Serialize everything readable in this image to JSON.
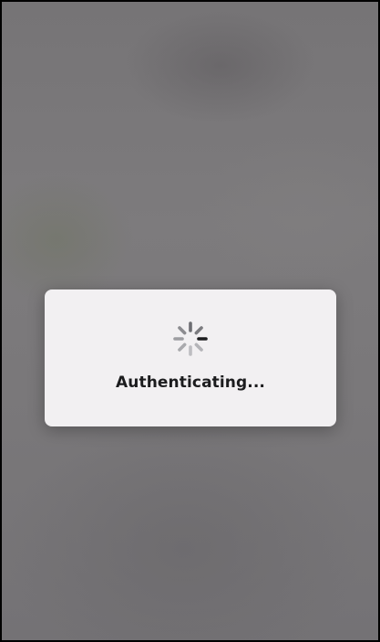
{
  "overlay": {
    "backdrop_color": "#7a787a",
    "dialog_color": "#f2f0f2"
  },
  "loading_dialog": {
    "spinner_icon": "activity-spinner-icon",
    "message": "Authenticating..."
  }
}
